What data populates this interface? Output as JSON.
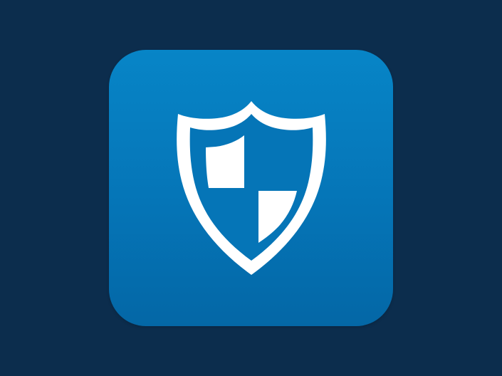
{
  "icon": {
    "name": "shield-icon",
    "tile_color": "#0677BA",
    "glyph_color": "#FFFFFF",
    "background_color": "#0C2D4D"
  }
}
